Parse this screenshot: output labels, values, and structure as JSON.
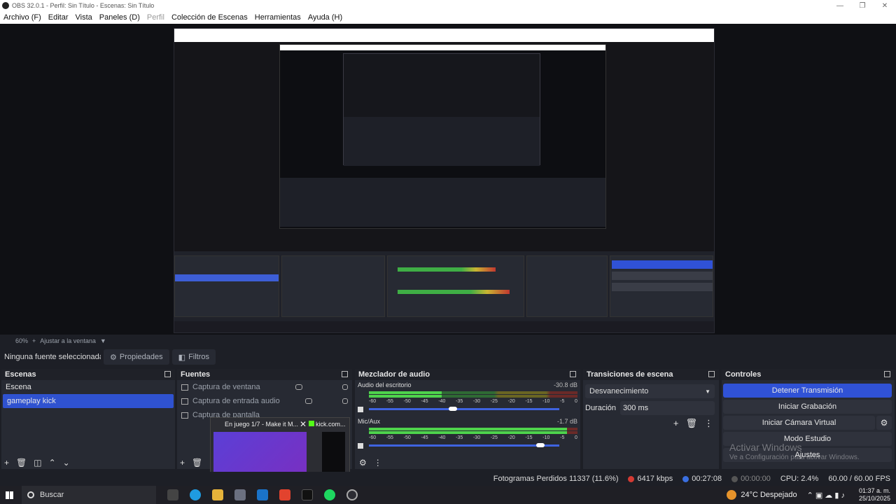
{
  "window": {
    "title": "OBS 32.0.1 - Perfil: Sin Título - Escenas: Sin Título",
    "controls": [
      "—",
      "❐",
      "✕"
    ]
  },
  "menu": [
    "Archivo (F)",
    "Editar",
    "Vista",
    "Paneles (D)",
    "Perfil",
    "Colección de Escenas",
    "Herramientas",
    "Ayuda (H)"
  ],
  "preview_toolbar": {
    "zoom": "60%",
    "fit": "Ajustar a la ventana"
  },
  "props_bar": {
    "no_selection": "Ninguna fuente seleccionada",
    "properties": "Propiedades",
    "filters": "Filtros"
  },
  "scenes": {
    "title": "Escenas",
    "items": [
      "Escena",
      "gameplay kick"
    ],
    "selected": "gameplay kick"
  },
  "sources": {
    "title": "Fuentes",
    "items": [
      "Captura de ventana",
      "Captura de entrada audio",
      "Captura de pantalla"
    ]
  },
  "mixer": {
    "title": "Mezclador de audio",
    "scale": [
      "-60",
      "-55",
      "-50",
      "-45",
      "-40",
      "-35",
      "-30",
      "-25",
      "-20",
      "-15",
      "-10",
      "-5",
      "0"
    ],
    "tracks": [
      {
        "name": "Audio del escritorio",
        "db": "-30.8 dB",
        "level": 0.35,
        "volume": 0.44
      },
      {
        "name": "Mic/Aux",
        "db": "-1.7 dB",
        "level": 0.95,
        "volume": 0.9
      }
    ]
  },
  "transitions": {
    "title": "Transiciones de escena",
    "type": "Desvanecimiento",
    "duration_label": "Duración",
    "duration": "300 ms"
  },
  "controls": {
    "title": "Controles",
    "stop_stream": "Detener Transmisión",
    "start_recording": "Iniciar Grabación",
    "virtual_cam": "Iniciar Cámara Virtual",
    "studio_mode": "Modo Estudio",
    "settings": "Ajustes"
  },
  "watermark": {
    "line1": "Activar Windows",
    "line2": "Ve a Configuración para activar Windows."
  },
  "popup": {
    "tab1": "En juego 1/7 - Make it M...",
    "tab2": "kick.com..."
  },
  "status": {
    "dropped": "Fotogramas Perdidos 11337 (11.6%)",
    "bitrate": "6417 kbps",
    "stream_time": "00:27:08",
    "rec_time": "00:00:00",
    "cpu": "CPU: 2.4%",
    "fps": "60.00 / 60.00 FPS"
  },
  "taskbar": {
    "search": "Buscar",
    "weather": "24°C  Despejado",
    "time": "01:37 a. m.",
    "date": "25/10/2025"
  },
  "colors": {
    "accent": "#3052d6",
    "bg": "#1d1f26",
    "panel": "#272a33"
  }
}
